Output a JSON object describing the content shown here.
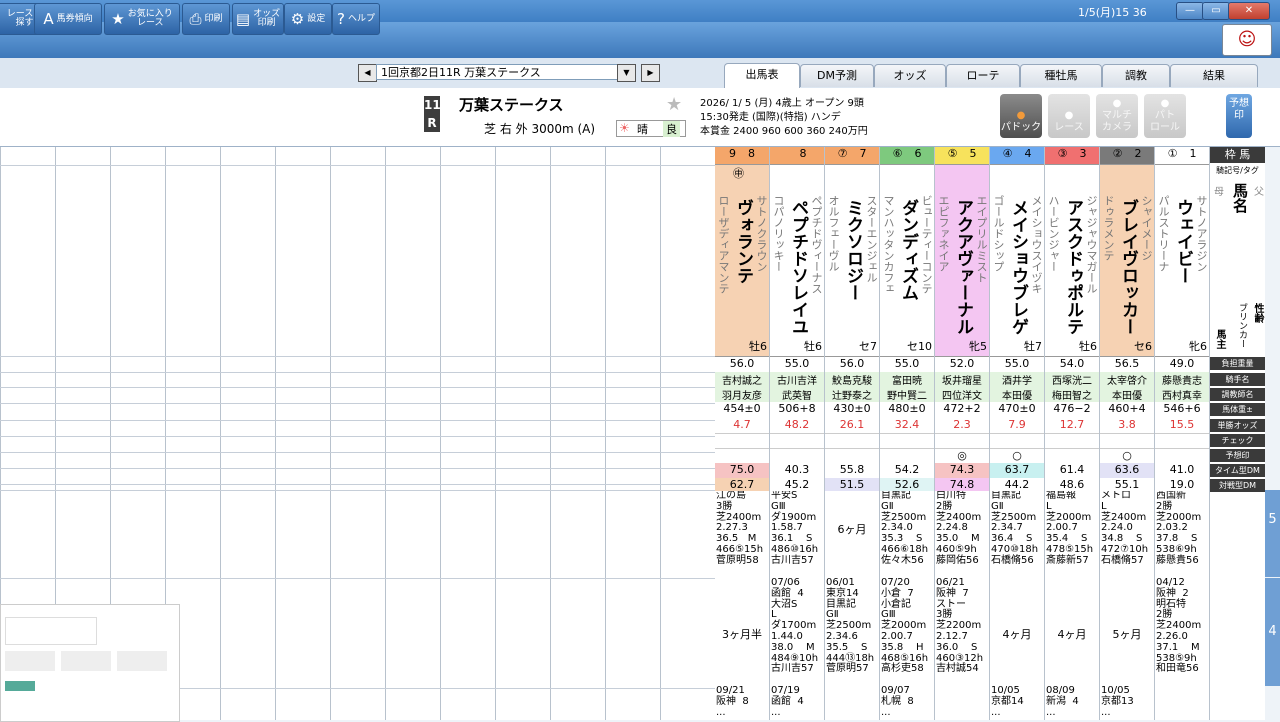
{
  "titlebar": {
    "clock": "1/5(月)15 36",
    "min": "—",
    "max": "▭",
    "close": "✕"
  },
  "toolbar": [
    {
      "icon": "",
      "label": "レースを\n探す"
    },
    {
      "icon": "A",
      "label": "馬券傾向"
    },
    {
      "icon": "★",
      "label": "お気に入り\nレース"
    },
    {
      "icon": "⎙",
      "label": "印刷"
    },
    {
      "icon": "▤",
      "label": "オッズ\n印刷"
    },
    {
      "icon": "⚙",
      "label": "設定"
    },
    {
      "icon": "?",
      "label": "ヘルプ"
    }
  ],
  "race_select": {
    "value": "1回京都2日11R 万葉ステークス",
    "prev": "◀",
    "next": "▶",
    "dropdown": "▼"
  },
  "tabs": [
    "出馬表",
    "DM予測",
    "オッズ",
    "ローテ",
    "種牡馬",
    "調教",
    "結果"
  ],
  "active_tab": 0,
  "race": {
    "number_top": "11",
    "number_bottom": "R",
    "name": "万葉ステークス",
    "course": "芝 右 外 3000m (A)",
    "weather": "晴",
    "going": "良",
    "info_line1": "2026/ 1/ 5 (月)  4歳上  オープン  9頭",
    "info_line2": "15:30発走  (国際)(特指)  ハンデ",
    "info_line3": "本賞金 2400 960 600 360 240万円"
  },
  "action_buttons": [
    {
      "label": "パドック",
      "enabled": true
    },
    {
      "label": "レース",
      "enabled": false
    },
    {
      "label": "マルチ\nカメラ",
      "enabled": false
    },
    {
      "label": "パト\nロール",
      "enabled": false
    }
  ],
  "yoso_button": "予想印",
  "legend_header": "枠 馬",
  "legend": {
    "sire": "父",
    "dam": "母",
    "name_label": "馬名",
    "blinker": "ブリンカー",
    "owner": "馬主",
    "sexage": "性齢",
    "tag": "騎記号/タグ",
    "rows": [
      "負担重量",
      "騎手名",
      "調教師名",
      "馬体重±",
      "単勝オッズ",
      "チェック",
      "予想印",
      "タイム型DM",
      "対戦型DM"
    ]
  },
  "row_numbers": [
    "5",
    "4"
  ],
  "horses": [
    {
      "waku": "9",
      "wakuCircle": "⑧",
      "num": "8",
      "wakuColor": "#f4a66a",
      "bg": "#f6d2b3",
      "mark": "㊥",
      "sire": "サトノクラウン",
      "name": "ヴォランテ",
      "dam": "ローザディアマンテ",
      "sexage": "牡6",
      "weight": "56.0",
      "jockey": "吉村誠之",
      "trainer": "羽月友彦",
      "bodyweight": "454±0",
      "odds": "4.7",
      "pred": "",
      "dmTime": "75.0",
      "dmVersus": "62.7",
      "dmTimeBg": "#f6c3c3",
      "dmVsBg": "#f6d2b3",
      "p1": "江の島\n3勝\n芝2400m\n2.27.3\n36.5   M\n466⑤15h\n菅原明58",
      "int1": "",
      "p2": "",
      "int2": "3ヶ月半",
      "p3": "09/21\n阪神  8\n..."
    },
    {
      "waku": "",
      "wakuCircle": "",
      "num": "8",
      "wakuColor": "#f4a66a",
      "bg": "#ffffff",
      "mark": "",
      "sire": "ペプチドヴィーナス",
      "name": "ペプチドソレイユ",
      "dam": "コパノリッキー",
      "sexage": "牡6",
      "weight": "55.0",
      "jockey": "古川吉洋",
      "trainer": "武英智",
      "bodyweight": "506+8",
      "odds": "48.2",
      "pred": "",
      "dmTime": "40.3",
      "dmVersus": "45.2",
      "dmTimeBg": "#ffffff",
      "dmVsBg": "#ffffff",
      "p1": "平安S\nGⅢ\nダ1900m\n1.58.7\n36.1    S\n486⑩16h\n古川吉57",
      "int1": "",
      "p2": "07/06\n函館  4\n大沼S\nL\nダ1700m\n1.44.0\n38.0    M\n484⑨10h\n古川吉57",
      "int2": "",
      "p3": "07/19\n函館  4\n..."
    },
    {
      "waku": "⑦",
      "wakuCircle": "",
      "num": "7",
      "wakuColor": "#f4a66a",
      "bg": "#ffffff",
      "mark": "",
      "sire": "スターエンジェル",
      "name": "ミクソロジー",
      "dam": "オルフェーヴル",
      "sexage": "セ7",
      "weight": "56.0",
      "jockey": "鮫島克駿",
      "trainer": "辻野泰之",
      "bodyweight": "430±0",
      "odds": "26.1",
      "pred": "",
      "dmTime": "55.8",
      "dmVersus": "51.5",
      "dmTimeBg": "#ffffff",
      "dmVsBg": "#e2e2f6",
      "p1": "",
      "int1": "6ヶ月",
      "p2": "06/01\n東京14\n目黒記\nGⅡ\n芝2500m\n2.34.6\n35.5    S\n444⑬18h\n菅原明57",
      "int2": "",
      "p3": ""
    },
    {
      "waku": "⑥",
      "wakuCircle": "",
      "num": "6",
      "wakuColor": "#7ec97e",
      "bg": "#ffffff",
      "mark": "",
      "sire": "ビューティーコンテ",
      "name": "ダンディズム",
      "dam": "マンハッタンカフェ",
      "sexage": "セ10",
      "weight": "55.0",
      "jockey": "富田暁",
      "trainer": "野中賢二",
      "bodyweight": "480±0",
      "odds": "32.4",
      "pred": "",
      "dmTime": "54.2",
      "dmVersus": "52.6",
      "dmTimeBg": "#ffffff",
      "dmVsBg": "#dff4f4",
      "p1": "目黒記\nGⅡ\n芝2500m\n2.34.0\n35.3    S\n466⑥18h\n佐々木56",
      "int1": "",
      "p2": "07/20\n小倉  7\n小倉記\nGⅢ\n芝2000m\n2.00.7\n35.8    H\n468⑤16h\n高杉吏58",
      "int2": "",
      "p3": "09/07\n札幌  8\n..."
    },
    {
      "waku": "⑤",
      "wakuCircle": "",
      "num": "5",
      "wakuColor": "#f7e25c",
      "bg": "#f4c6f2",
      "mark": "",
      "sire": "エイプリルミスト",
      "name": "アクアヴァーナル",
      "dam": "エピファネイア",
      "sexage": "牝5",
      "weight": "52.0",
      "jockey": "坂井瑠星",
      "trainer": "四位洋文",
      "bodyweight": "472+2",
      "odds": "2.3",
      "pred": "◎",
      "dmTime": "74.3",
      "dmVersus": "74.8",
      "dmTimeBg": "#f6c3c3",
      "dmVsBg": "#f4c6f2",
      "p1": "白川特\n2勝\n芝2400m\n2.24.8\n35.0    M\n460⑤9h\n藤岡佑56",
      "int1": "",
      "p2": "06/21\n阪神  7\nストー\n3勝\n芝2200m\n2.12.7\n36.0    S\n460③12h\n吉村誠54",
      "int2": "",
      "p3": ""
    },
    {
      "waku": "④",
      "wakuCircle": "",
      "num": "4",
      "wakuColor": "#6aa8f0",
      "bg": "#ffffff",
      "mark": "",
      "sire": "メイショウスイヅキ",
      "name": "メイショウブレゲ",
      "dam": "ゴールドシップ",
      "sexage": "牡7",
      "weight": "55.0",
      "jockey": "酒井学",
      "trainer": "本田優",
      "bodyweight": "470±0",
      "odds": "7.9",
      "pred": "○",
      "dmTime": "63.7",
      "dmVersus": "44.2",
      "dmTimeBg": "#c8f0f0",
      "dmVsBg": "#ffffff",
      "p1": "目黒記\nGⅡ\n芝2500m\n2.34.7\n36.4    S\n470⑩18h\n石橋脩56",
      "int1": "",
      "p2": "",
      "int2": "4ヶ月",
      "p3": "10/05\n京都14\n..."
    },
    {
      "waku": "③",
      "wakuCircle": "",
      "num": "3",
      "wakuColor": "#f07070",
      "bg": "#ffffff",
      "mark": "",
      "sire": "ジャジャウマガール",
      "name": "アスクドゥポルテ",
      "dam": "ハービンジャー",
      "sexage": "牡6",
      "weight": "54.0",
      "jockey": "西塚洸二",
      "trainer": "梅田智之",
      "bodyweight": "476−2",
      "odds": "12.7",
      "pred": "",
      "dmTime": "61.4",
      "dmVersus": "48.6",
      "dmTimeBg": "#ffffff",
      "dmVsBg": "#ffffff",
      "p1": "福島報\nL\n芝2000m\n2.00.7\n35.4    S\n478⑤15h\n斎藤新57",
      "int1": "",
      "p2": "",
      "int2": "4ヶ月",
      "p3": "08/09\n新潟  4\n..."
    },
    {
      "waku": "②",
      "wakuCircle": "",
      "num": "2",
      "wakuColor": "#7a7a7a",
      "bg": "#f6d2b3",
      "mark": "",
      "sire": "シャイメージ",
      "name": "ブレイヴロッカー",
      "dam": "ドゥラメンテ",
      "sexage": "セ6",
      "weight": "56.5",
      "jockey": "太宰啓介",
      "trainer": "本田優",
      "bodyweight": "460+4",
      "odds": "3.8",
      "pred": "○",
      "dmTime": "63.6",
      "dmVersus": "55.1",
      "dmTimeBg": "#e2e2f6",
      "dmVsBg": "#ffffff",
      "p1": "メトロ\nL\n芝2400m\n2.24.0\n34.8    S\n472⑦10h\n石橋脩57",
      "int1": "",
      "p2": "",
      "int2": "5ヶ月",
      "p3": "10/05\n京都13\n..."
    },
    {
      "waku": "①",
      "wakuCircle": "",
      "num": "1",
      "wakuColor": "#ffffff",
      "bg": "#ffffff",
      "mark": "",
      "sire": "サトノアラジン",
      "name": "ウェイビー",
      "dam": "パルストリーナ",
      "sexage": "牝6",
      "weight": "49.0",
      "jockey": "藤懸貴志",
      "trainer": "西村真幸",
      "bodyweight": "546+6",
      "odds": "15.5",
      "pred": "",
      "dmTime": "41.0",
      "dmVersus": "19.0",
      "dmTimeBg": "#ffffff",
      "dmVsBg": "#ffffff",
      "p1": "西国新\n2勝\n芝2000m\n2.03.2\n37.8    S\n538⑥9h\n藤懸貴56",
      "int1": "",
      "p2": "04/12\n阪神  2\n明石特\n2勝\n芝2400m\n2.26.0\n37.1    M\n538⑤9h\n和田竜56",
      "int2": "",
      "p3": ""
    }
  ]
}
